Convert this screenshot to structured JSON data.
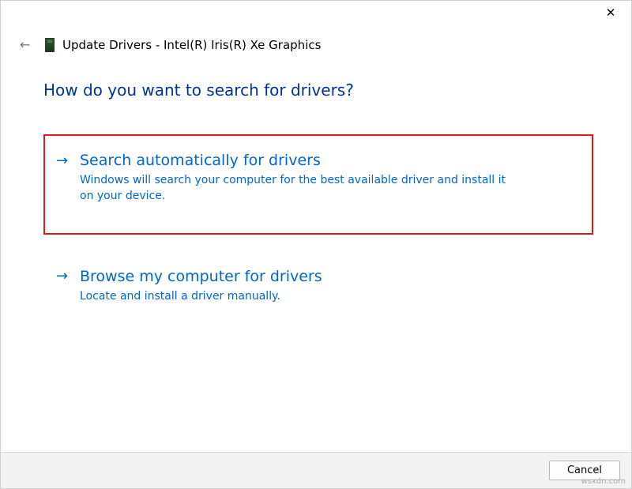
{
  "titlebar": {
    "close_glyph": "✕"
  },
  "header": {
    "back_glyph": "←",
    "title": "Update Drivers - Intel(R) Iris(R) Xe Graphics"
  },
  "content": {
    "heading": "How do you want to search for drivers?",
    "options": [
      {
        "arrow": "→",
        "title": "Search automatically for drivers",
        "description": "Windows will search your computer for the best available driver and install it on your device.",
        "highlighted": true
      },
      {
        "arrow": "→",
        "title": "Browse my computer for drivers",
        "description": "Locate and install a driver manually.",
        "highlighted": false
      }
    ]
  },
  "footer": {
    "cancel_label": "Cancel"
  },
  "watermark": "wsxdn.com"
}
